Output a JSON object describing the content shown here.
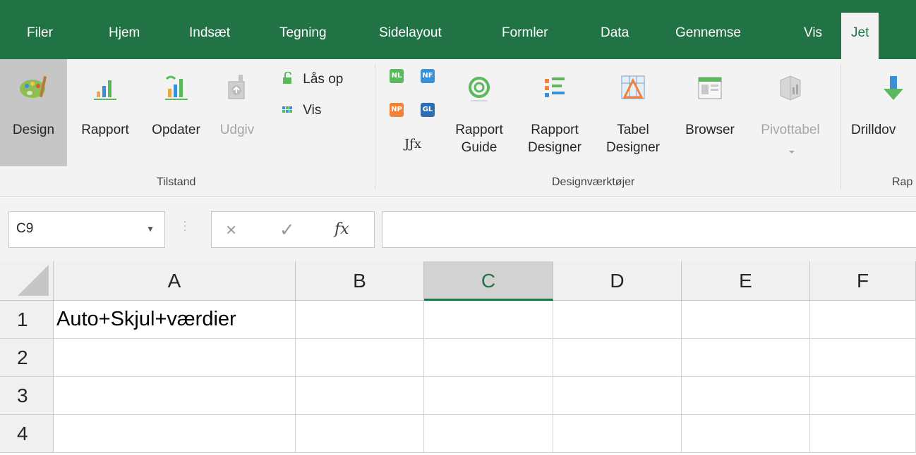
{
  "tabs": [
    "Filer",
    "Hjem",
    "Indsæt",
    "Tegning",
    "Sidelayout",
    "Formler",
    "Data",
    "Gennemse",
    "Vis",
    "Jet"
  ],
  "active_tab": "Jet",
  "ribbon": {
    "tilstand": {
      "label": "Tilstand",
      "design": "Design",
      "rapport": "Rapport",
      "opdater": "Opdater",
      "udgiv": "Udgiv",
      "laas_op": "Lås op",
      "vis": "Vis"
    },
    "design_tools": {
      "label": "Designværktøjer",
      "nl": "NL",
      "nf": "NF",
      "np": "NP",
      "gl": "GL",
      "jfx": "Jƒx",
      "rapport_guide_1": "Rapport",
      "rapport_guide_2": "Guide",
      "rapport_designer_1": "Rapport",
      "rapport_designer_2": "Designer",
      "tabel_designer_1": "Tabel",
      "tabel_designer_2": "Designer",
      "browser": "Browser",
      "pivottabel": "Pivottabel"
    },
    "next_group": {
      "drilldown": "Drilldov",
      "label": "Rap"
    }
  },
  "formula_bar": {
    "name_box": "C9",
    "cancel": "×",
    "enter": "✓",
    "fx": "fx",
    "value": ""
  },
  "grid": {
    "columns": [
      "A",
      "B",
      "C",
      "D",
      "E",
      "F"
    ],
    "selected_column": "C",
    "rows": [
      "1",
      "2",
      "3",
      "4"
    ],
    "cells": {
      "A1": "Auto+Skjul+værdier"
    }
  },
  "colors": {
    "accent": "#217346",
    "ribbon_bg": "#f3f3f3"
  }
}
